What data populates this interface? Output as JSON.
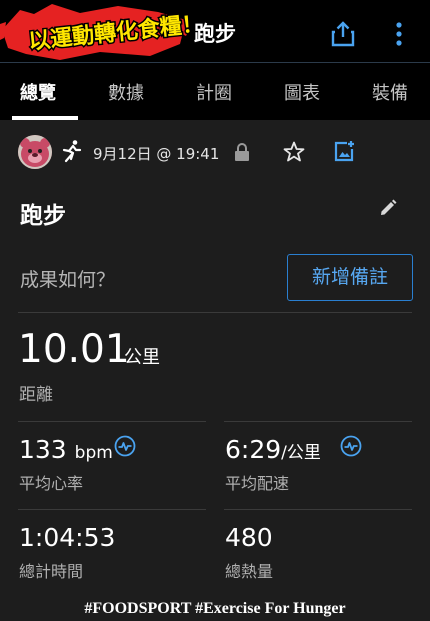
{
  "header": {
    "logo_text": "以運動轉化食糧！",
    "title": "跑步",
    "share_icon": "share-icon",
    "more_icon": "more-vert-icon"
  },
  "tabs": [
    {
      "label": "總覽",
      "active": true
    },
    {
      "label": "數據",
      "active": false
    },
    {
      "label": "計圈",
      "active": false
    },
    {
      "label": "圖表",
      "active": false
    },
    {
      "label": "裝備",
      "active": false
    }
  ],
  "meta": {
    "date": "9月12日 @ 19:41",
    "icons": [
      "avatar",
      "running-icon",
      "lock-icon",
      "star-icon",
      "add-photo-icon"
    ]
  },
  "activity": {
    "title": "跑步",
    "notes_prompt": "成果如何？",
    "add_note_label": "新增備註"
  },
  "stats": {
    "distance": {
      "value": "10.01",
      "unit": "公里",
      "label": "距離"
    },
    "heart_rate": {
      "value": "133",
      "unit": "bpm",
      "label": "平均心率"
    },
    "pace": {
      "value": "6:29",
      "unit": "/公里",
      "label": "平均配速"
    },
    "total_time": {
      "value": "1:04:53",
      "label": "總計時間"
    },
    "calories": {
      "value": "480",
      "label": "總熱量"
    }
  },
  "footer": {
    "text": "#FOODSPORT #Exercise For Hunger"
  },
  "colors": {
    "background": "#1d1d1d",
    "bar": "#000000",
    "accent": "#2a7fd0",
    "logo_red": "#e52222",
    "logo_yellow": "#ffe600"
  }
}
